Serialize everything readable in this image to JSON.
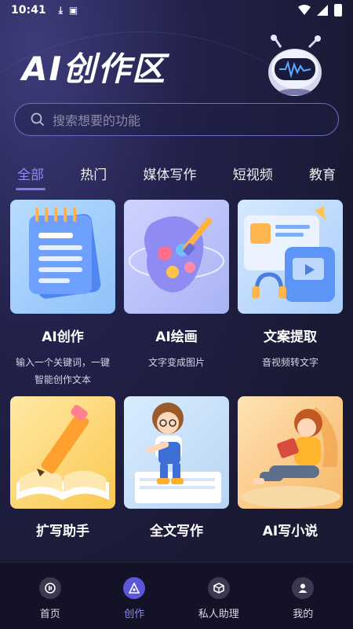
{
  "status_bar": {
    "time": "10:41"
  },
  "header": {
    "title": "AI创作区"
  },
  "search": {
    "placeholder": "搜索想要的功能"
  },
  "tabs": [
    {
      "label": "全部",
      "active": true
    },
    {
      "label": "热门"
    },
    {
      "label": "媒体写作"
    },
    {
      "label": "短视频"
    },
    {
      "label": "教育"
    }
  ],
  "cards": [
    {
      "name": "AI创作",
      "desc": "输入一个关键词，一键智能创作文本",
      "icon": "notepad-illustration"
    },
    {
      "name": "AI绘画",
      "desc": "文字变成图片",
      "icon": "palette-illustration"
    },
    {
      "name": "文案提取",
      "desc": "音视频转文字",
      "icon": "media-extract-illustration"
    },
    {
      "name": "扩写助手",
      "desc": "",
      "icon": "book-pencil-illustration"
    },
    {
      "name": "全文写作",
      "desc": "",
      "icon": "girl-writing-illustration"
    },
    {
      "name": "AI写小说",
      "desc": "",
      "icon": "girl-reading-illustration"
    }
  ],
  "bottom_nav": [
    {
      "label": "首页",
      "icon": "home-icon"
    },
    {
      "label": "创作",
      "icon": "create-icon",
      "active": true
    },
    {
      "label": "私人助理",
      "icon": "assistant-icon"
    },
    {
      "label": "我的",
      "icon": "profile-icon"
    }
  ],
  "colors": {
    "accent": "#7d79e8",
    "background": "#1b1a35",
    "nav_bg": "#131226"
  }
}
